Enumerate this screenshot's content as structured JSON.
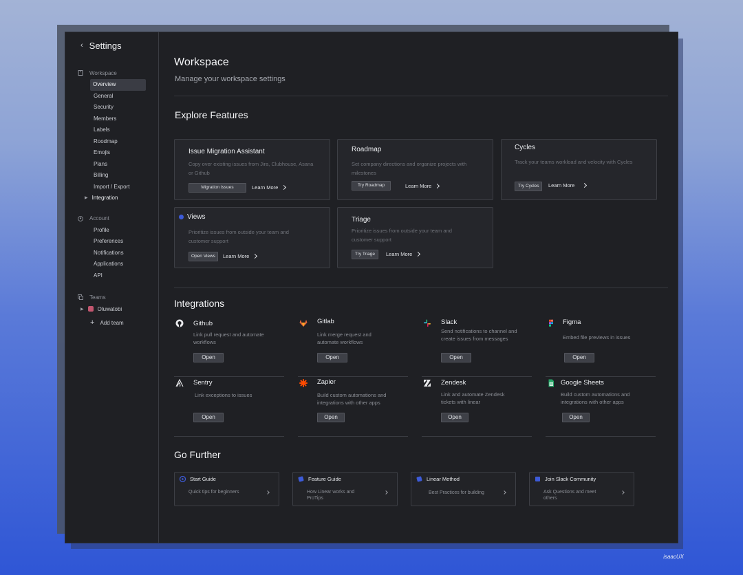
{
  "sidebar": {
    "title": "Settings",
    "workspace": {
      "label": "Workspace",
      "items": [
        "Overview",
        "General",
        "Security",
        "Members",
        "Labels",
        "Roodmap",
        "Emojis",
        "Plans",
        "Billing",
        "Import / Export"
      ],
      "integration": "Integration"
    },
    "account": {
      "label": "Account",
      "items": [
        "Profile",
        "Preferences",
        "Notifications",
        "Applications",
        "API"
      ]
    },
    "teams": {
      "label": "Teams",
      "team": "Oluwatobi",
      "add": "Add team"
    }
  },
  "main": {
    "title": "Workspace",
    "subtitle": "Manage your workspace settings",
    "explore": {
      "heading": "Explore Features",
      "cards": [
        {
          "title": "Issue Migration Assistant",
          "desc": "Copy over existing issues from Jira, Clubhouse, Asana or Github",
          "button": "Migration Issues",
          "link": "Learn More"
        },
        {
          "title": "Roadmap",
          "desc": "Set company directions and organize projects with milestones",
          "button": "Try Roadmap",
          "link": "Learn More"
        },
        {
          "title": "Cycles",
          "desc": "Track your teams workload and velocity with Cycles",
          "button": "Try Cycles",
          "link": "Learn More"
        },
        {
          "title": "Views",
          "desc": "Prioritize issues from outside your team and customer support",
          "button": "Open Views",
          "link": "Learn More"
        },
        {
          "title": "Triage",
          "desc": "Prioritize issues from outside your team and customer support",
          "button": "Try Triage",
          "link": "Learn More"
        }
      ]
    },
    "integrations": {
      "heading": "Integrations",
      "items": [
        {
          "name": "Github",
          "desc": "Link pull request and automate workflows",
          "button": "Open",
          "icon": "github-icon"
        },
        {
          "name": "Gitlab",
          "desc": "Link merge request and automate workflows",
          "button": "Open",
          "icon": "gitlab-icon"
        },
        {
          "name": "Slack",
          "desc": "Send notifications to channel and create issues from messages",
          "button": "Open",
          "icon": "slack-icon"
        },
        {
          "name": "Figma",
          "desc": "Embed file previews in issues",
          "button": "Open",
          "icon": "figma-icon"
        },
        {
          "name": "Sentry",
          "desc": "Link exceptions to issues",
          "button": "Open",
          "icon": "sentry-icon"
        },
        {
          "name": "Zapier",
          "desc": "Build custom automations and integrations with other apps",
          "button": "Open",
          "icon": "zapier-icon"
        },
        {
          "name": "Zendesk",
          "desc": "Link and automate Zendesk tickets with linear",
          "button": "Open",
          "icon": "zendesk-icon"
        },
        {
          "name": "Google Sheets",
          "desc": "Build custom automations and integrations with other apps",
          "button": "Open",
          "icon": "google-sheets-icon"
        }
      ]
    },
    "further": {
      "heading": "Go Further",
      "items": [
        {
          "title": "Start Guide",
          "desc": "Quick tips for beginners"
        },
        {
          "title": "Feature Guide",
          "desc": "How Linear works and ProTips"
        },
        {
          "title": "Linear Method",
          "desc": "Best Practices for building"
        },
        {
          "title": "Join Slack Community",
          "desc": "Ask Questions and meet others"
        }
      ]
    }
  },
  "credit": "isaacUX",
  "colors": {
    "accent": "#3d5bd8",
    "background": "#1f2024",
    "card": "#25262b"
  }
}
